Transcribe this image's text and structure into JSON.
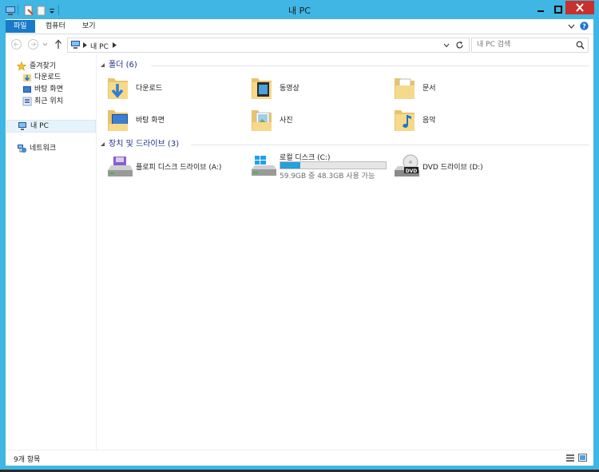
{
  "window": {
    "title": "내 PC"
  },
  "ribbon": {
    "tabs": [
      "파일",
      "컴퓨터",
      "보기"
    ]
  },
  "nav": {
    "address_crumb": "내 PC",
    "search_placeholder": "내 PC 검색"
  },
  "sidebar": {
    "favorites": "즐겨찾기",
    "fav_items": [
      "다운로드",
      "바탕 화면",
      "최근 위치"
    ],
    "this_pc": "내 PC",
    "network": "네트워크"
  },
  "folders": {
    "header": "폴더 (6)",
    "items": [
      "다운로드",
      "동영상",
      "문서",
      "바탕 화면",
      "사진",
      "음악"
    ]
  },
  "drives": {
    "header": "장치 및 드라이브 (3)",
    "floppy": "플로피 디스크 드라이브 (A:)",
    "local": {
      "name": "로컬 디스크 (C:)",
      "free_text": "59.9GB 중 48.3GB 사용 가능",
      "used_fraction": 0.19
    },
    "dvd": "DVD 드라이브 (D:)"
  },
  "status": {
    "item_count": "9개 항목"
  },
  "colors": {
    "frame": "#3fb6e3",
    "file_tab": "#1979ca",
    "accent_header": "#1e3287",
    "close": "#c7312c"
  }
}
